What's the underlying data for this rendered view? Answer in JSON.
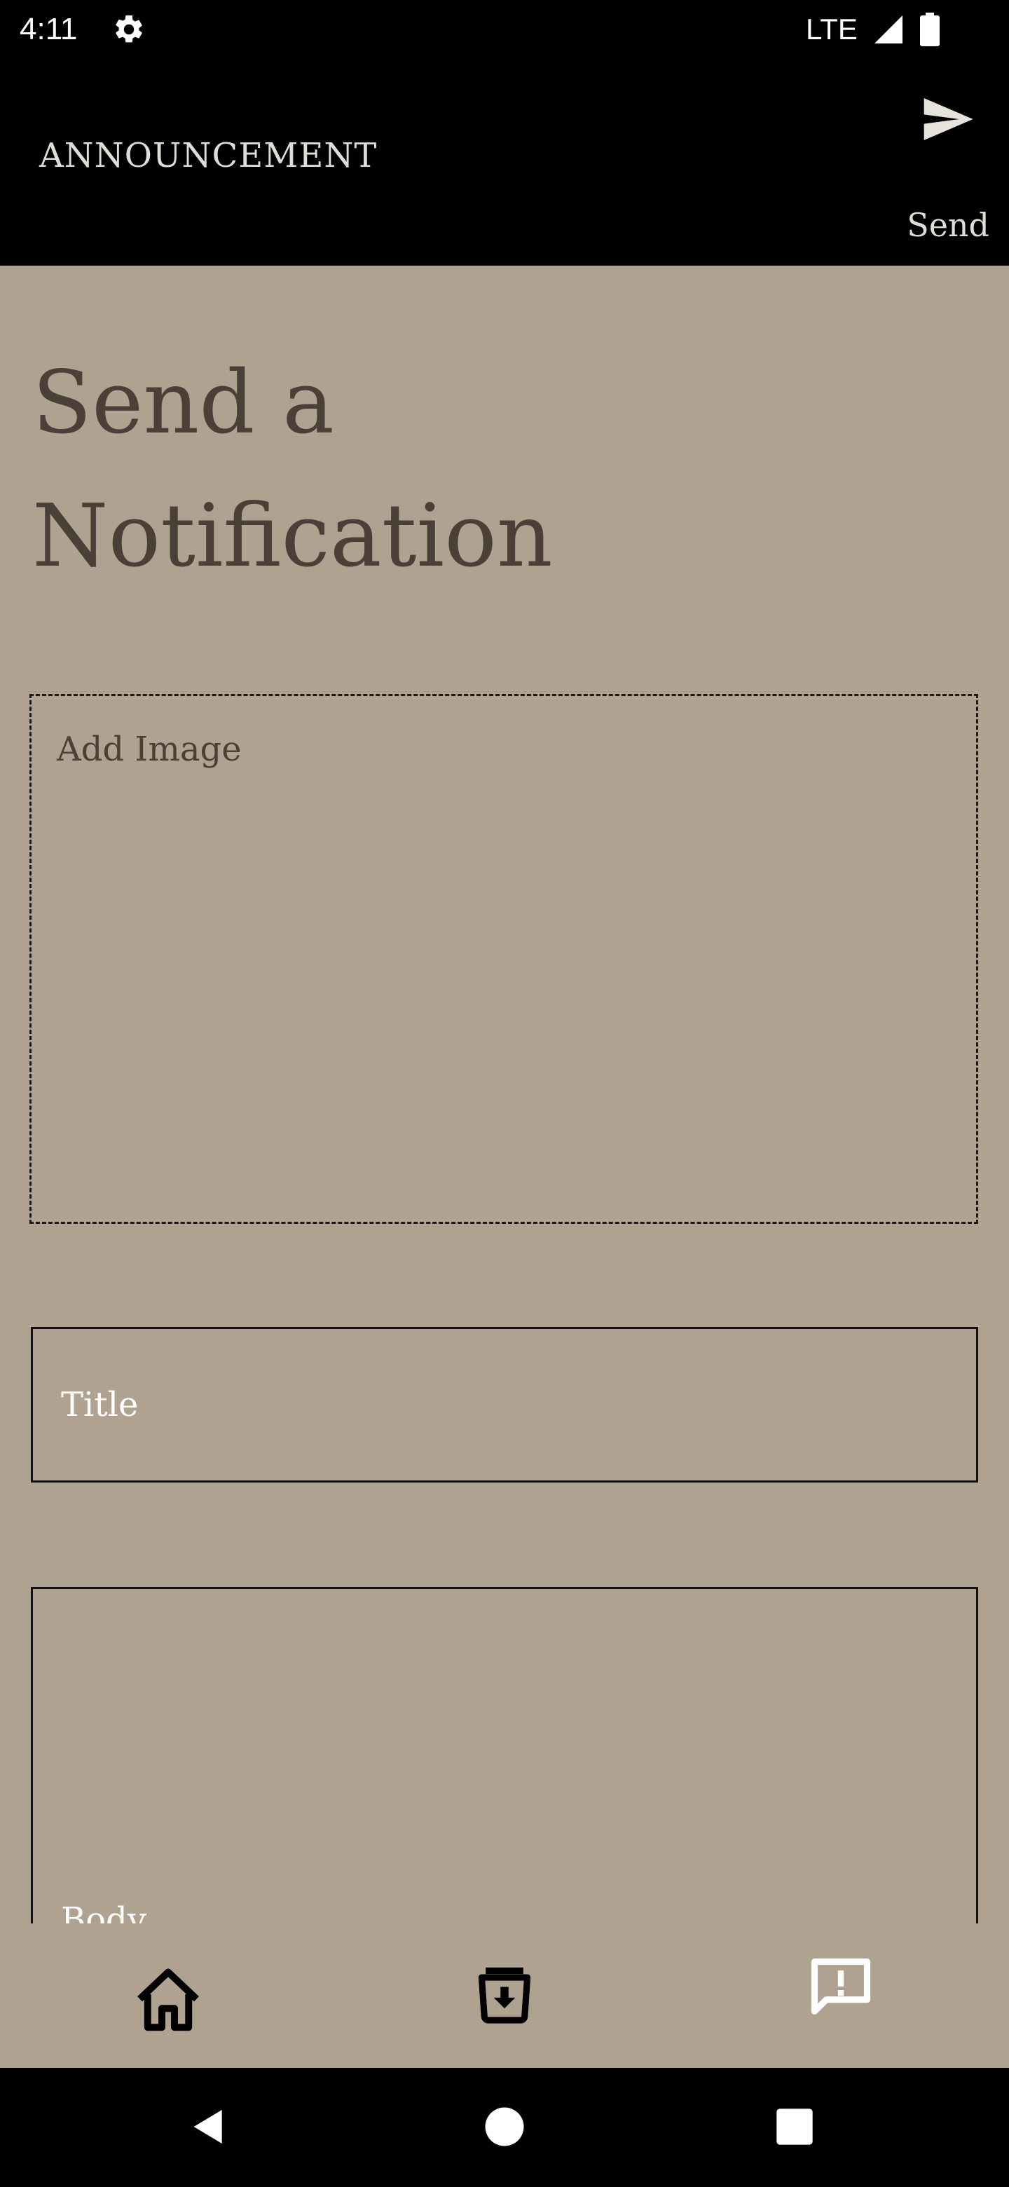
{
  "status_bar": {
    "time": "4:11",
    "network": "LTE",
    "icons": [
      "gear-icon",
      "signal-icon",
      "battery-icon"
    ]
  },
  "app_bar": {
    "title": "ANNOUNCEMENT",
    "send_label": "Send",
    "send_icon": "send-icon"
  },
  "main": {
    "page_title": "Send a Notification",
    "image_drop_label": "Add Image",
    "title_placeholder": "Title",
    "body_placeholder": "Body"
  },
  "bottom_nav": {
    "items": [
      {
        "icon": "home-icon"
      },
      {
        "icon": "archive-icon"
      },
      {
        "icon": "announcement-icon"
      }
    ]
  },
  "system_nav": {
    "buttons": [
      "back-icon",
      "home-circle-icon",
      "recents-icon"
    ]
  },
  "colors": {
    "background": "#afa290",
    "app_bar": "#000000",
    "heading_text": "#4a4038",
    "placeholder_text": "#ffffff"
  }
}
